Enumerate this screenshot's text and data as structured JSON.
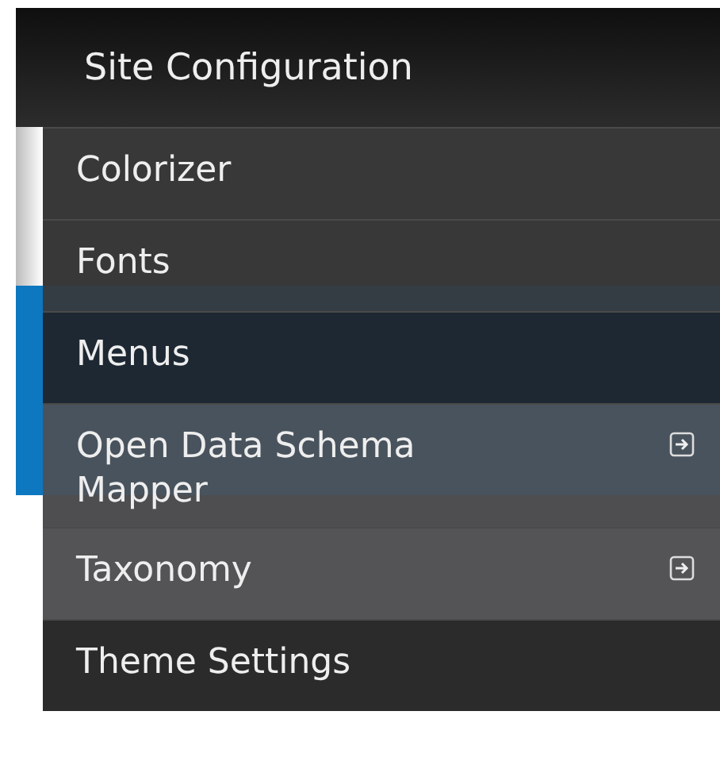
{
  "menu": {
    "title": "Site Configuration",
    "items": [
      {
        "label": "Colorizer",
        "kind": "link"
      },
      {
        "label": "Fonts",
        "kind": "link"
      },
      {
        "label": "Menus",
        "kind": "link"
      },
      {
        "label": "Open Data Schema Mapper",
        "kind": "external"
      },
      {
        "label": "Taxonomy",
        "kind": "external"
      },
      {
        "label": "Theme Settings",
        "kind": "link"
      }
    ]
  }
}
